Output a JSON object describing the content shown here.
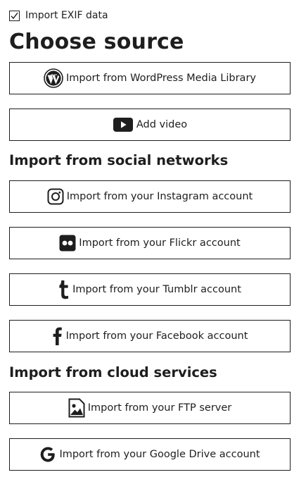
{
  "exif": {
    "label": "Import EXIF data",
    "checked": true
  },
  "title": "Choose source",
  "sources": [
    {
      "icon": "wordpress-icon",
      "label": "Import from WordPress Media Library"
    },
    {
      "icon": "youtube-icon",
      "label": "Add video"
    }
  ],
  "social": {
    "heading": "Import from social networks",
    "items": [
      {
        "icon": "instagram-icon",
        "label": "Import from your Instagram account"
      },
      {
        "icon": "flickr-icon",
        "label": "Import from your Flickr account"
      },
      {
        "icon": "tumblr-icon",
        "label": "Import from your Tumblr account"
      },
      {
        "icon": "facebook-icon",
        "label": "Import from your Facebook account"
      }
    ]
  },
  "cloud": {
    "heading": "Import from cloud services",
    "items": [
      {
        "icon": "image-file-icon",
        "label": "Import from your FTP server"
      },
      {
        "icon": "google-icon",
        "label": "Import from your Google Drive account"
      }
    ]
  }
}
